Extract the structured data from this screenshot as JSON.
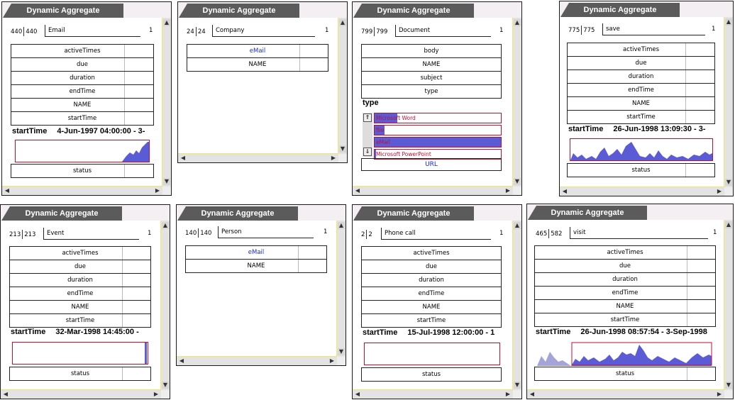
{
  "panel_title": "Dynamic Aggregate",
  "one_label": "1",
  "panels": [
    {
      "count_a": "440",
      "count_b": "440",
      "label": "Email",
      "attrs": [
        "activeTimes",
        "due",
        "duration",
        "endTime",
        "NAME",
        "startTime"
      ],
      "range_name": "startTime",
      "range_value": "4-Jun-1997 04:00:00  -  3-",
      "bottom_attr": "status"
    },
    {
      "count_a": "24",
      "count_b": "24",
      "label": "Company",
      "attrs": [
        "eMail",
        "NAME"
      ]
    },
    {
      "count_a": "799",
      "count_b": "799",
      "label": "Document",
      "attrs": [
        "body",
        "NAME",
        "subject",
        "type"
      ],
      "type_heading": "type",
      "type_items": [
        "Microsoft Word",
        "file",
        "eMail",
        "Microsoft PowerPoint"
      ],
      "type_fill": [
        0.18,
        0.08,
        1.0,
        0.01
      ],
      "url_label": "URL"
    },
    {
      "count_a": "775",
      "count_b": "775",
      "label": "save",
      "attrs": [
        "activeTimes",
        "due",
        "duration",
        "endTime",
        "NAME",
        "startTime"
      ],
      "range_name": "startTime",
      "range_value": "26-Jun-1998 13:09:30  -  3-",
      "bottom_attr": "status"
    },
    {
      "count_a": "213",
      "count_b": "213",
      "label": "Event",
      "attrs": [
        "activeTimes",
        "due",
        "duration",
        "endTime",
        "NAME",
        "startTime"
      ],
      "range_name": "startTime",
      "range_value": "32-Mar-1998 14:45:00  -",
      "bottom_attr": "status"
    },
    {
      "count_a": "140",
      "count_b": "140",
      "label": "Person",
      "attrs": [
        "eMail",
        "NAME"
      ]
    },
    {
      "count_a": "2",
      "count_b": "2",
      "label": "Phone call",
      "attrs": [
        "activeTimes",
        "due",
        "duration",
        "endTime",
        "NAME",
        "startTime"
      ],
      "range_name": "startTime",
      "range_value": "15-Jul-1998 12:00:00  -  1",
      "bottom_attr": "status"
    },
    {
      "count_a": "465",
      "count_b": "582",
      "label": "visit",
      "attrs": [
        "activeTimes",
        "due",
        "duration",
        "endTime",
        "NAME",
        "startTime"
      ],
      "range_name": "startTime",
      "range_value": "26-Jun-1998 08:57:54  -  3-Sep-1998",
      "bottom_attr": "status"
    }
  ],
  "colors": {
    "accent_red": "#c01030",
    "link_blue": "#1a2bd0",
    "spark_fill": "#5b5bd6",
    "scroll_edge": "#f4e66a"
  }
}
